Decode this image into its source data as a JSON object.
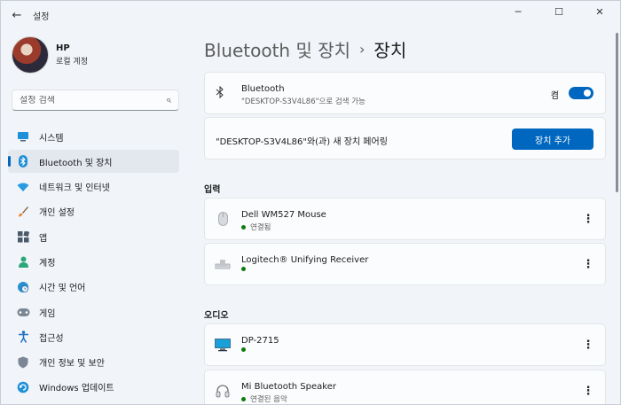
{
  "app": {
    "title": "설정"
  },
  "titlebar": {
    "back_icon": "arrow-left-icon",
    "minimize": "─",
    "maximize": "☐",
    "close": "✕"
  },
  "profile": {
    "name": "HP",
    "account": "로컬 계정"
  },
  "search": {
    "placeholder": "설정 검색"
  },
  "sidebar": {
    "items": [
      {
        "label": "시스템",
        "icon": "monitor-icon"
      },
      {
        "label": "Bluetooth 및 장치",
        "icon": "bluetooth-icon",
        "active": true
      },
      {
        "label": "네트워크 및 인터넷",
        "icon": "wifi-icon"
      },
      {
        "label": "개인 설정",
        "icon": "brush-icon"
      },
      {
        "label": "앱",
        "icon": "apps-icon"
      },
      {
        "label": "계정",
        "icon": "person-icon"
      },
      {
        "label": "시간 및 언어",
        "icon": "globe-clock-icon"
      },
      {
        "label": "게임",
        "icon": "gamepad-icon"
      },
      {
        "label": "접근성",
        "icon": "accessibility-icon"
      },
      {
        "label": "개인 정보 및 보안",
        "icon": "shield-icon"
      },
      {
        "label": "Windows 업데이트",
        "icon": "update-icon"
      }
    ]
  },
  "breadcrumb": {
    "parent": "Bluetooth 및 장치",
    "separator": "›",
    "current": "장치"
  },
  "bluetooth": {
    "title": "Bluetooth",
    "subtitle": "\"DESKTOP-S3V4L86\"으로 검색 가능",
    "toggle_label": "켬",
    "toggle_on": true
  },
  "pairing": {
    "text": "\"DESKTOP-S3V4L86\"와(과) 새 장치 페어링",
    "button": "장치 추가"
  },
  "sections": {
    "input": {
      "title": "입력",
      "devices": [
        {
          "name": "Dell WM527 Mouse",
          "status": "연결됨",
          "icon": "mouse-icon"
        },
        {
          "name": "Logitech® Unifying Receiver",
          "status": "",
          "icon": "keyboard-icon"
        }
      ]
    },
    "audio": {
      "title": "오디오",
      "devices": [
        {
          "name": "DP-2715",
          "status": "",
          "icon": "display-icon"
        },
        {
          "name": "Mi Bluetooth Speaker",
          "status": "연결된 음악",
          "icon": "headphones-icon"
        }
      ]
    }
  },
  "colors": {
    "accent": "#0067c0",
    "connected": "#0f7b0f",
    "window_bg": "#f1f4f9",
    "card_bg": "#fbfcfd"
  }
}
